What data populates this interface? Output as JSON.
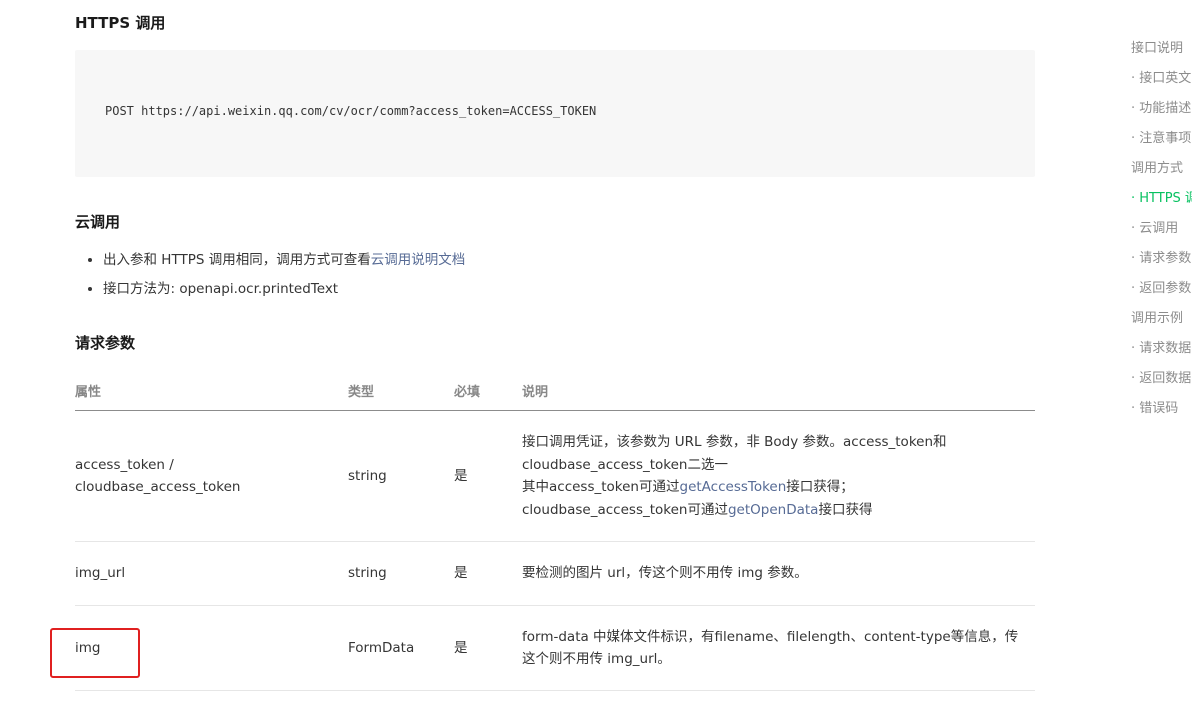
{
  "https_section": {
    "title": "HTTPS 调用",
    "code": "POST https://api.weixin.qq.com/cv/ocr/comm?access_token=ACCESS_TOKEN"
  },
  "cloud_section": {
    "title": "云调用",
    "bullet1_prefix": "出入参和 HTTPS 调用相同，调用方式可查看",
    "bullet1_link": "云调用说明文档",
    "bullet2": "接口方法为: openapi.ocr.printedText"
  },
  "params_section": {
    "title": "请求参数",
    "headers": [
      "属性",
      "类型",
      "必填",
      "说明"
    ],
    "rows": [
      {
        "name_line1": "access_token /",
        "name_line2": "cloudbase_access_token",
        "type": "string",
        "required": "是",
        "desc_line1": "接口调用凭证，该参数为 URL 参数，非 Body 参数。access_token和",
        "desc_line2": "cloudbase_access_token二选一",
        "desc_line3_prefix": "其中access_token可通过",
        "desc_line3_link": "getAccessToken",
        "desc_line3_suffix": "接口获得；",
        "desc_line4_prefix": "cloudbase_access_token可通过",
        "desc_line4_link": "getOpenData",
        "desc_line4_suffix": "接口获得"
      },
      {
        "name": "img_url",
        "type": "string",
        "required": "是",
        "desc": "要检测的图片 url，传这个则不用传 img 参数。"
      },
      {
        "name": "img",
        "type": "FormData",
        "required": "是",
        "desc_line1": "form-data 中媒体文件标识，有filename、filelength、content-type等信息，传",
        "desc_line2": "这个则不用传 img_url。"
      }
    ]
  },
  "toc": {
    "items": [
      {
        "label": "接口说明"
      },
      {
        "label": "· 接口英文"
      },
      {
        "label": "· 功能描述"
      },
      {
        "label": "· 注意事项"
      },
      {
        "label": "调用方式"
      },
      {
        "label": "· HTTPS 调"
      },
      {
        "label": "· 云调用"
      },
      {
        "label": "· 请求参数"
      },
      {
        "label": "· 返回参数"
      },
      {
        "label": "调用示例"
      },
      {
        "label": "· 请求数据"
      },
      {
        "label": "· 返回数据"
      },
      {
        "label": "· 错误码"
      }
    ],
    "active_color": "#07c160"
  },
  "colors": {
    "link": "#576b95",
    "highlight_border": "#e02020"
  }
}
